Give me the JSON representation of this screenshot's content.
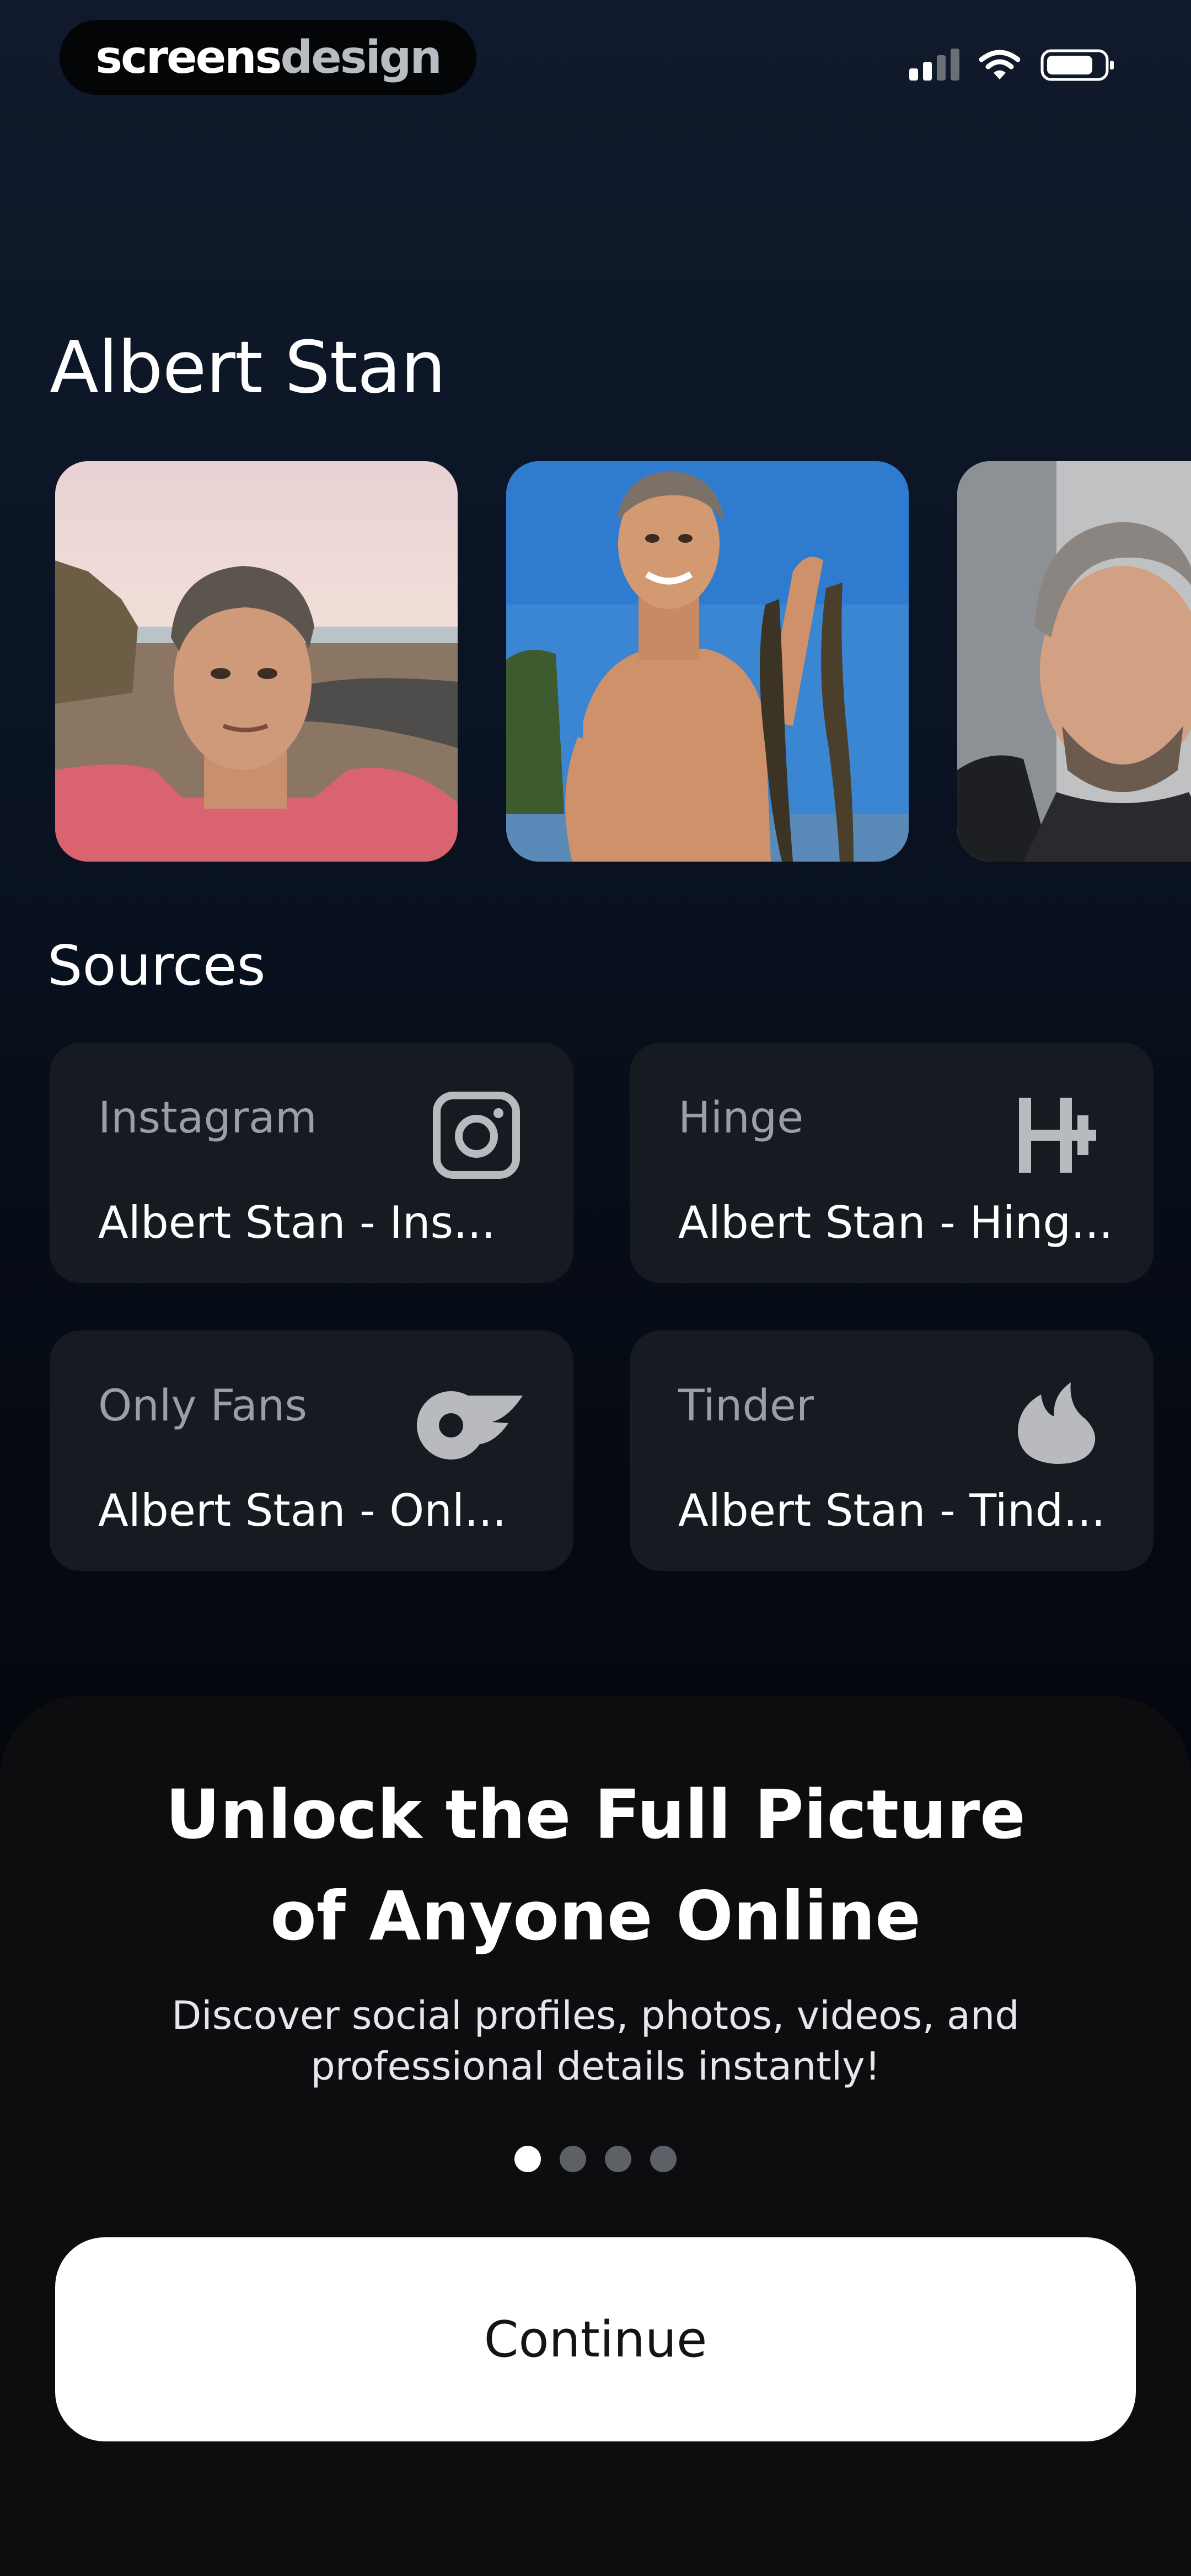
{
  "status_bar": {
    "brand_part1": "screens",
    "brand_part2": "design"
  },
  "profile": {
    "name": "Albert Stan",
    "photos": [
      {
        "icon": "beach-selfie-photo"
      },
      {
        "icon": "fishing-photo"
      },
      {
        "icon": "car-selfie-photo"
      }
    ]
  },
  "sources": {
    "title": "Sources",
    "items": [
      {
        "platform": "Instagram",
        "account": "Albert Stan - Ins...",
        "icon": "instagram-icon"
      },
      {
        "platform": "Hinge",
        "account": "Albert Stan - Hing...",
        "icon": "hinge-icon"
      },
      {
        "platform": "Only Fans",
        "account": "Albert Stan - Onl...",
        "icon": "onlyfans-icon"
      },
      {
        "platform": "Tinder",
        "account": "Albert Stan - Tind...",
        "icon": "tinder-icon"
      }
    ]
  },
  "onboarding": {
    "headline_line1": "Unlock the Full Picture",
    "headline_line2": "of Anyone Online",
    "subtext_line1": "Discover social profiles, photos, videos, and",
    "subtext_line2": "professional details instantly!",
    "page_indicator": {
      "current": 1,
      "total": 4
    },
    "continue_label": "Continue"
  },
  "colors": {
    "background_top": "#101a2c",
    "card": "#161a21",
    "sheet": "#0d0d0f",
    "button": "#ffffff",
    "icon_gray": "#b8babe"
  }
}
